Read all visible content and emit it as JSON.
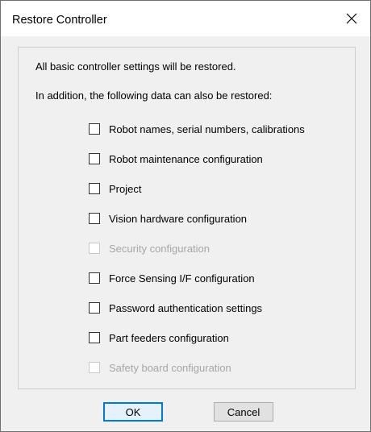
{
  "dialog": {
    "title": "Restore Controller",
    "close_glyph": "close-icon"
  },
  "info": {
    "line1": "All basic controller settings will be restored.",
    "line2": "In addition, the following data can also be restored:"
  },
  "options": [
    {
      "label": "Robot names, serial numbers, calibrations",
      "checked": false,
      "enabled": true
    },
    {
      "label": "Robot maintenance configuration",
      "checked": false,
      "enabled": true
    },
    {
      "label": "Project",
      "checked": false,
      "enabled": true
    },
    {
      "label": "Vision hardware configuration",
      "checked": false,
      "enabled": true
    },
    {
      "label": "Security configuration",
      "checked": false,
      "enabled": false
    },
    {
      "label": "Force Sensing I/F configuration",
      "checked": false,
      "enabled": true
    },
    {
      "label": "Password authentication settings",
      "checked": false,
      "enabled": true
    },
    {
      "label": "Part feeders configuration",
      "checked": false,
      "enabled": true
    },
    {
      "label": "Safety board configuration",
      "checked": false,
      "enabled": false
    }
  ],
  "buttons": {
    "ok_label": "OK",
    "cancel_label": "Cancel"
  },
  "colors": {
    "default_button_border": "#0078d7",
    "disabled_text": "#a6a6a6",
    "dialog_background": "#f0f0f0"
  }
}
